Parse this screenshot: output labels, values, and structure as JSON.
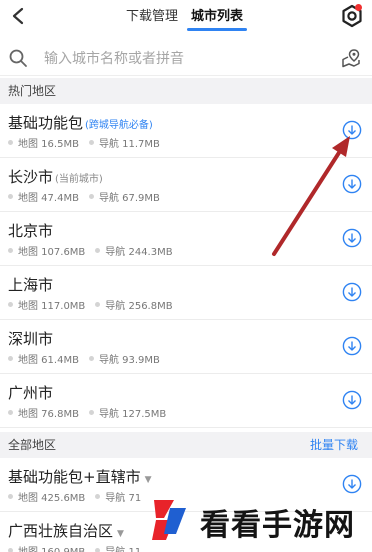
{
  "tabs": [
    {
      "label": "下载管理"
    },
    {
      "label": "城市列表"
    }
  ],
  "search": {
    "placeholder": "输入城市名称或者拼音"
  },
  "sections": {
    "hot": "热门地区",
    "all": "全部地区",
    "batch_download": "批量下载"
  },
  "hot_items": [
    {
      "name": "基础功能包",
      "tag": "(跨城导航必备)",
      "map": "地图 16.5MB",
      "nav": "导航 11.7MB"
    },
    {
      "name": "长沙市",
      "tag": "(当前城市)",
      "map": "地图 47.4MB",
      "nav": "导航 67.9MB"
    },
    {
      "name": "北京市",
      "tag": "",
      "map": "地图 107.6MB",
      "nav": "导航 244.3MB"
    },
    {
      "name": "上海市",
      "tag": "",
      "map": "地图 117.0MB",
      "nav": "导航 256.8MB"
    },
    {
      "name": "深圳市",
      "tag": "",
      "map": "地图 61.4MB",
      "nav": "导航 93.9MB"
    },
    {
      "name": "广州市",
      "tag": "",
      "map": "地图 76.8MB",
      "nav": "导航 127.5MB"
    }
  ],
  "all_items": [
    {
      "name": "基础功能包+直辖市",
      "map": "地图 425.6MB",
      "nav": "导航 71"
    },
    {
      "name": "广西壮族自治区",
      "map": "地图 160.9MB",
      "nav": "导航 11"
    }
  ],
  "watermark": {
    "text": "看看手游网"
  },
  "colors": {
    "accent": "#2f83f2",
    "arrow": "#b0282a",
    "section_bg": "#f2f2f4"
  }
}
